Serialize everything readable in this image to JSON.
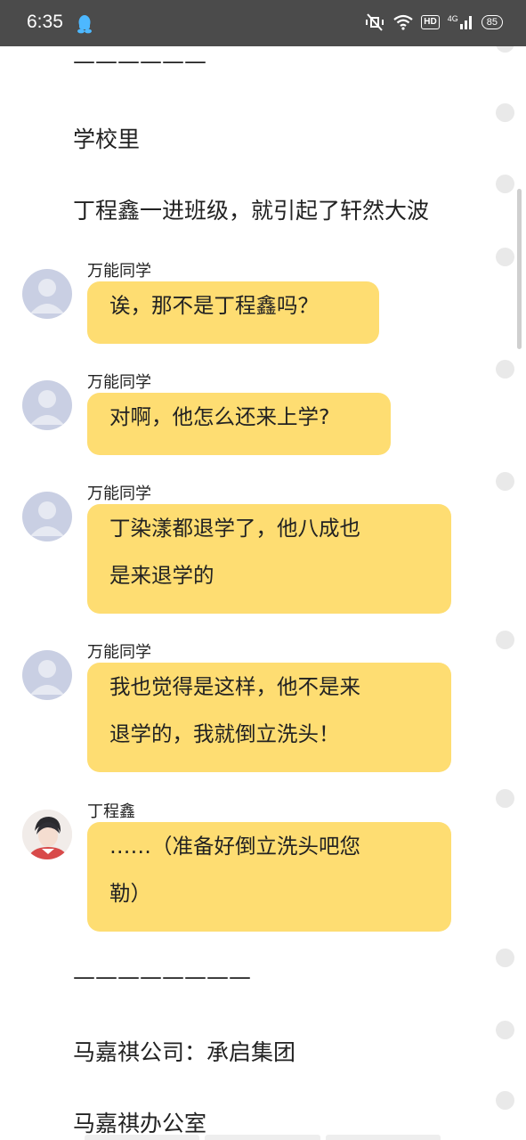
{
  "status_bar": {
    "time": "6:35",
    "hd_label": "HD",
    "network_label": "4G",
    "battery": "85"
  },
  "narration": {
    "divider_top": "——————",
    "line_school": "学校里",
    "line_enter": "丁程鑫一进班级，就引起了轩然大波",
    "divider_mid": "————————",
    "line_company": "马嘉祺公司：承启集团",
    "line_office": "马嘉祺办公室"
  },
  "messages": [
    {
      "sender": "万能同学",
      "lines": [
        "诶，那不是丁程鑫吗？"
      ],
      "avatar": "default-avatar"
    },
    {
      "sender": "万能同学",
      "lines": [
        "对啊，他怎么还来上学?"
      ],
      "avatar": "default-avatar"
    },
    {
      "sender": "万能同学",
      "lines": [
        "丁染漾都退学了，他八成也",
        "是来退学的"
      ],
      "avatar": "default-avatar"
    },
    {
      "sender": "万能同学",
      "lines": [
        "我也觉得是这样，他不是来",
        "退学的，我就倒立洗头！"
      ],
      "avatar": "default-avatar"
    },
    {
      "sender": "丁程鑫",
      "lines": [
        "……（准备好倒立洗头吧您",
        "勒）"
      ],
      "avatar": "character-photo-avatar"
    }
  ],
  "colors": {
    "status_bar_bg": "#4b4b4b",
    "bubble_bg": "#fedd72",
    "default_avatar_bg": "#c9cfe3",
    "text": "#222222",
    "side_dot": "#e9e9e9"
  }
}
